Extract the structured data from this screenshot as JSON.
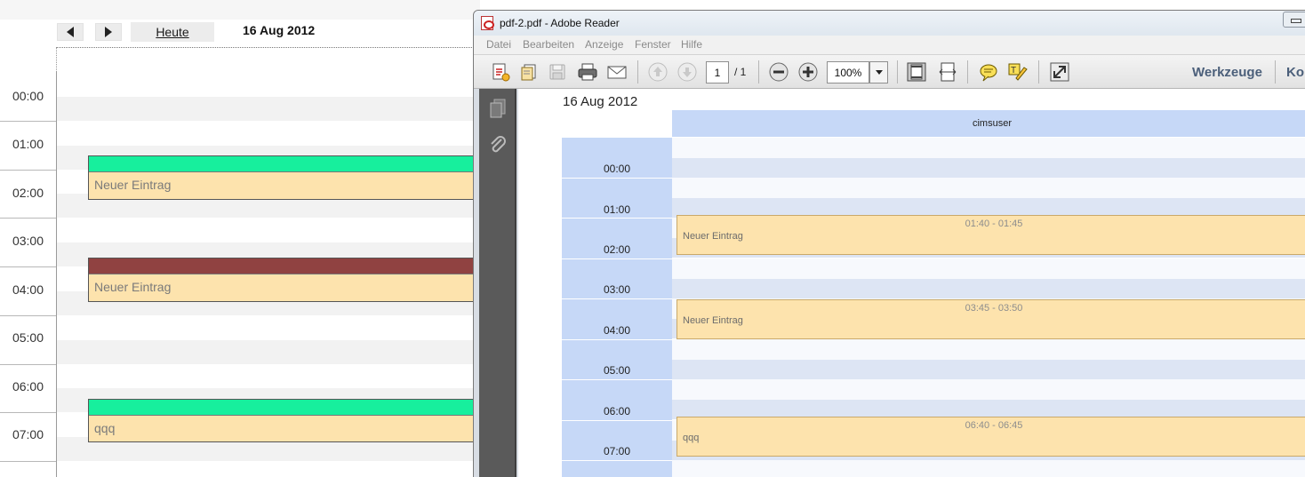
{
  "calendar": {
    "nav": {
      "prev_icon": "triangle-left-icon",
      "next_icon": "triangle-right-icon"
    },
    "today_label": "Heute",
    "date_label": "16 Aug 2012",
    "hours": [
      "00:00",
      "01:00",
      "02:00",
      "03:00",
      "04:00",
      "05:00",
      "06:00",
      "07:00"
    ],
    "events": [
      {
        "title": "Neuer Eintrag",
        "bar_color": "#17ef9d"
      },
      {
        "title": "Neuer Eintrag",
        "bar_color": "#904241"
      },
      {
        "title": "qqq",
        "bar_color": "#17ef9d"
      }
    ]
  },
  "reader": {
    "title": "pdf-2.pdf - Adobe Reader",
    "menu": [
      "Datei",
      "Bearbeiten",
      "Anzeige",
      "Fenster",
      "Hilfe"
    ],
    "toolbar": {
      "page_current": "1",
      "page_total": "/ 1",
      "zoom": "100%",
      "tools_label": "Werkzeuge",
      "comment_label": "Kommentar"
    },
    "pdf": {
      "date": "16 Aug 2012",
      "user": "cimsuser",
      "hours": [
        "00:00",
        "01:00",
        "02:00",
        "03:00",
        "04:00",
        "05:00",
        "06:00",
        "07:00"
      ],
      "events": [
        {
          "time": "01:40 - 01:45",
          "title": "Neuer Eintrag"
        },
        {
          "time": "03:45 - 03:50",
          "title": "Neuer Eintrag"
        },
        {
          "time": "06:40 - 06:45",
          "title": "qqq"
        }
      ]
    }
  }
}
